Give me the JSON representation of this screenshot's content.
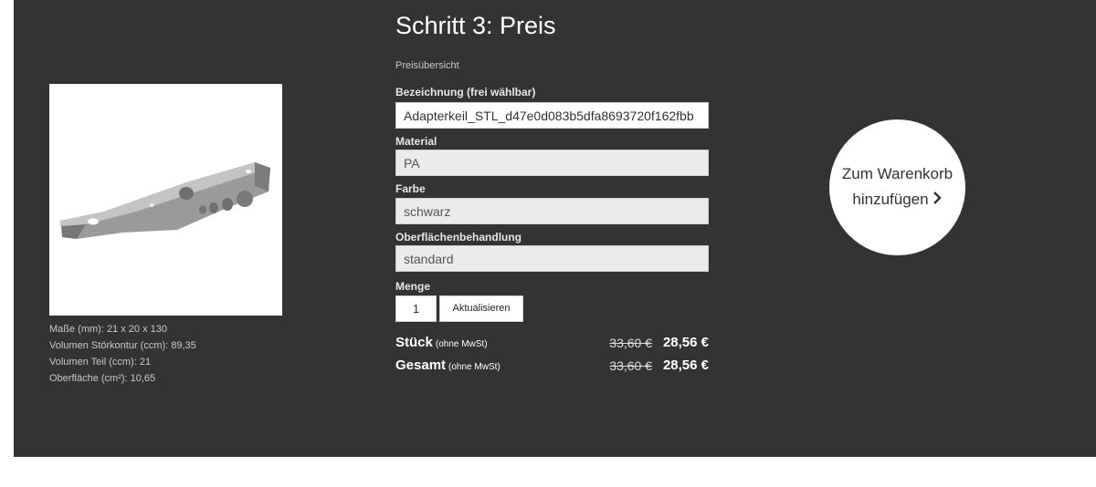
{
  "step_title": "Schritt 3: Preis",
  "section_label": "Preisübersicht",
  "fields": {
    "name_label": "Bezeichnung (frei wählbar)",
    "name_value": "Adapterkeil_STL_d47e0d083b5dfa8693720f162fbb",
    "material_label": "Material",
    "material_value": "PA",
    "color_label": "Farbe",
    "color_value": "schwarz",
    "surface_label": "Oberflächenbehandlung",
    "surface_value": "standard",
    "quantity_label": "Menge",
    "quantity_value": "1",
    "update_label": "Aktualisieren"
  },
  "pricing": {
    "unit_label": "Stück",
    "unit_note": "(ohne MwSt)",
    "unit_old": "33,60 €",
    "unit_new": "28,56 €",
    "total_label": "Gesamt",
    "total_note": "(ohne MwSt)",
    "total_old": "33,60 €",
    "total_new": "28,56 €"
  },
  "specs": {
    "dimensions": "Maße (mm): 21 x 20 x 130",
    "collision_volume": "Volumen Störkontur (ccm): 89,35",
    "part_volume": "Volumen Teil (ccm): 21",
    "surface_area": "Oberfläche (cm²): 10,65"
  },
  "cart": {
    "line1": "Zum Warenkorb",
    "line2": "hinzufügen"
  },
  "icons": {
    "cart_chevron": "chevron-right-icon"
  },
  "colors": {
    "panel_bg": "#333333",
    "text_light": "#ffffff"
  }
}
